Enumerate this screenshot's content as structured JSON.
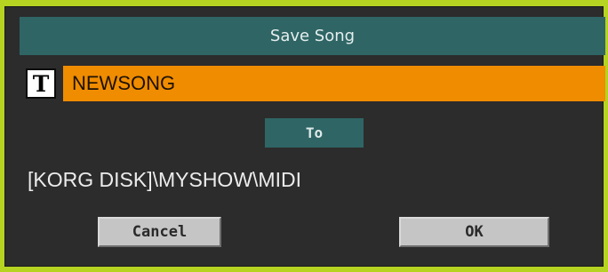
{
  "dialog": {
    "title": "Save Song",
    "name_field": {
      "icon": "text-edit-icon",
      "icon_glyph": "T",
      "value": "NEWSONG"
    },
    "to_button_label": "To",
    "destination_path": "[KORG DISK]\\MYSHOW\\MIDI",
    "cancel_label": "Cancel",
    "ok_label": "OK"
  },
  "colors": {
    "frame": "#b6d322",
    "background": "#2c2c2c",
    "title_bar": "#2f6565",
    "name_field": "#f08c00",
    "button": "#c5c5c5"
  }
}
